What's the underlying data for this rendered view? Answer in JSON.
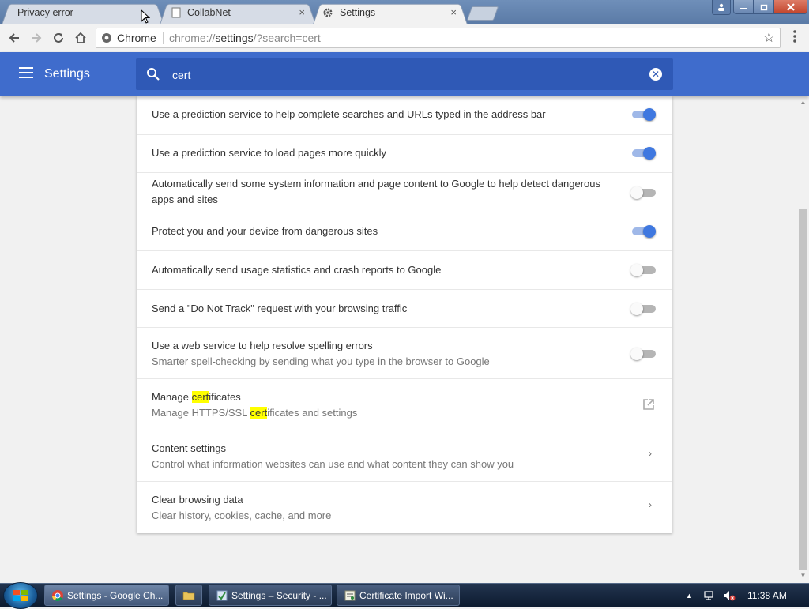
{
  "tabs": [
    {
      "title": "Privacy error",
      "active": false
    },
    {
      "title": "CollabNet",
      "active": false
    },
    {
      "title": "Settings",
      "active": true
    }
  ],
  "tab_close_glyph": "×",
  "window": {
    "min_glyph": "▬",
    "max_glyph": "▢",
    "close_glyph": "✕",
    "user_glyph": "👤"
  },
  "toolbar": {
    "back_glyph": "←",
    "forward_glyph": "→",
    "reload_glyph": "⟳",
    "home_glyph": "⌂",
    "chip": "Chrome",
    "url_host": "chrome://",
    "url_path": "settings",
    "url_query": "/?search=cert",
    "star_glyph": "☆",
    "menu_glyph": "⋮"
  },
  "header": {
    "title": "Settings",
    "search_value": "cert",
    "clear_glyph": "✕"
  },
  "settings": {
    "rows": [
      {
        "label": "Use a prediction service to help complete searches and URLs typed in the address bar",
        "toggle": "on"
      },
      {
        "label": "Use a prediction service to load pages more quickly",
        "toggle": "on"
      },
      {
        "label": "Automatically send some system information and page content to Google to help detect dangerous apps and sites",
        "toggle": "off"
      },
      {
        "label": "Protect you and your device from dangerous sites",
        "toggle": "on"
      },
      {
        "label": "Automatically send usage statistics and crash reports to Google",
        "toggle": "off"
      },
      {
        "label": "Send a \"Do Not Track\" request with your browsing traffic",
        "toggle": "off"
      },
      {
        "label": "Use a web service to help resolve spelling errors",
        "sublabel": "Smarter spell-checking by sending what you type in the browser to Google",
        "toggle": "off"
      },
      {
        "label_pre": "Manage ",
        "label_hl": "cert",
        "label_post": "ificates",
        "sub_pre": "Manage HTTPS/SSL ",
        "sub_hl": "cert",
        "sub_post": "ificates and settings",
        "action": "external-link"
      },
      {
        "label": "Content settings",
        "sublabel": "Control what information websites can use and what content they can show you",
        "action": "chevron"
      },
      {
        "label": "Clear browsing data",
        "sublabel": "Clear history, cookies, cache, and more",
        "action": "chevron"
      }
    ],
    "chevron_glyph": "›"
  },
  "taskbar": {
    "items": [
      {
        "label": "Settings - Google Ch...",
        "active": true
      },
      {
        "label": "",
        "icon": "folder-icon"
      },
      {
        "label": "Settings – Security - ...",
        "active": false
      },
      {
        "label": "Certificate Import Wi...",
        "active": false
      }
    ],
    "tray_up_glyph": "▲",
    "clock": "11:38 AM"
  },
  "colors": {
    "header_blue": "#3f6ccc",
    "search_blue": "#2f59b6",
    "toggle_on": "#3f78e0",
    "highlight": "#ffff00"
  }
}
